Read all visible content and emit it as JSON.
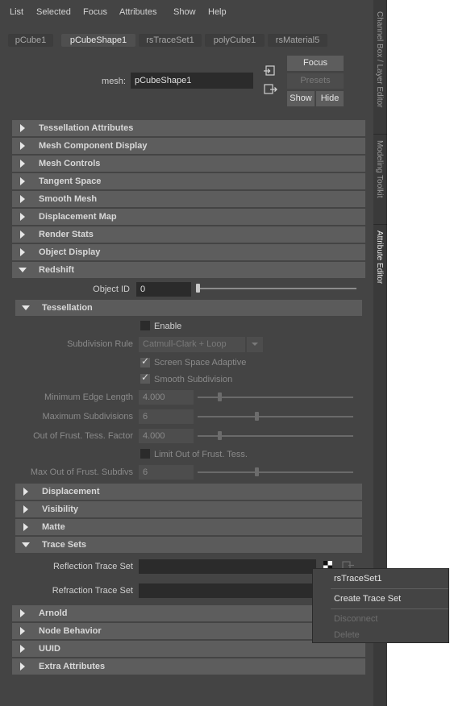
{
  "menu": [
    "List",
    "Selected",
    "Focus",
    "Attributes",
    "Show",
    "Help"
  ],
  "side_tabs": [
    "Channel Box / Layer Editor",
    "Modeling Toolkit",
    "Attribute Editor"
  ],
  "tabs": [
    "pCube1",
    "pCubeShape1",
    "rsTraceSet1",
    "polyCube1",
    "rsMaterial5"
  ],
  "header": {
    "mesh_label": "mesh:",
    "mesh_value": "pCubeShape1",
    "focus": "Focus",
    "presets": "Presets",
    "show": "Show",
    "hide": "Hide"
  },
  "sections": [
    "Tessellation Attributes",
    "Mesh Component Display",
    "Mesh Controls",
    "Tangent Space",
    "Smooth Mesh",
    "Displacement Map",
    "Render Stats",
    "Object Display",
    "Redshift"
  ],
  "redshift": {
    "object_id_label": "Object ID",
    "object_id_value": "0",
    "tessellation": "Tessellation",
    "enable": "Enable",
    "subdivision_rule_label": "Subdivision Rule",
    "subdivision_rule_value": "Catmull-Clark + Loop",
    "screen_space_adaptive": "Screen Space Adaptive",
    "smooth_subdivision": "Smooth Subdivision",
    "min_edge_length_label": "Minimum Edge Length",
    "min_edge_length_value": "4.000",
    "max_subdivisions_label": "Maximum Subdivisions",
    "max_subdivisions_value": "6",
    "out_frust_factor_label": "Out of Frust. Tess. Factor",
    "out_frust_factor_value": "4.000",
    "limit_out_frust": "Limit Out of Frust. Tess.",
    "max_out_frust_label": "Max Out of Frust. Subdivs",
    "max_out_frust_value": "6",
    "subsections": [
      "Displacement",
      "Visibility",
      "Matte",
      "Trace Sets"
    ],
    "reflection_trace_set": "Reflection Trace Set",
    "refraction_trace_set": "Refraction Trace Set"
  },
  "bottom_sections": [
    "Arnold",
    "Node Behavior",
    "UUID",
    "Extra Attributes"
  ],
  "context_menu": [
    "rsTraceSet1",
    "Create Trace Set",
    "Disconnect",
    "Delete"
  ]
}
